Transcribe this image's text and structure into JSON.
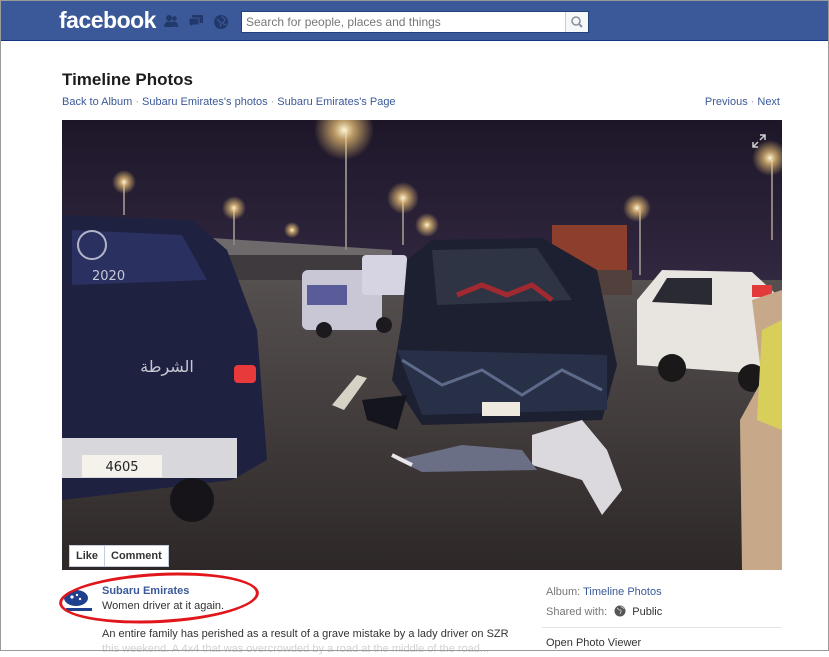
{
  "app": {
    "brand": "facebook"
  },
  "search": {
    "placeholder": "Search for people, places and things"
  },
  "header": {
    "title": "Timeline Photos",
    "breadcrumbs": [
      "Back to Album",
      "Subaru Emirates's photos",
      "Subaru Emirates's Page"
    ],
    "pager": {
      "previous": "Previous",
      "next": "Next"
    }
  },
  "photo": {
    "actions": {
      "like": "Like",
      "comment": "Comment"
    },
    "plate_text": "4605",
    "vehicle_text": "الشرطة",
    "sticker_text": "2020"
  },
  "post": {
    "author": "Subaru Emirates",
    "status": "Women driver at it again.",
    "description": "An entire family has perished as a result of a grave mistake by a lady driver on SZR",
    "description_cont": "this weekend. A 4x4 that was overcrowded by a road at the middle of the road..."
  },
  "sidebar": {
    "album_label": "Album:",
    "album_value": "Timeline Photos",
    "shared_label": "Shared with:",
    "shared_value": "Public",
    "more": "Open Photo Viewer"
  },
  "colors": {
    "brand": "#3b5998",
    "highlight": "#e0161b"
  }
}
